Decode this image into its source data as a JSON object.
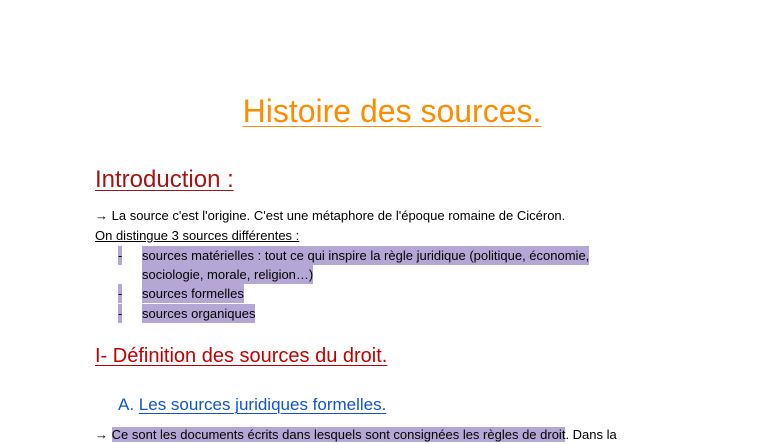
{
  "title": "Histoire des sources.",
  "introduction": {
    "heading": "Introduction :",
    "line1_arrow": "→",
    "line1": "La source c'est l'origine. C'est une métaphore de l'époque romaine de Cicéron.",
    "line2": "On distingue 3 sources différentes :",
    "bullet_marker": "-",
    "items": [
      "sources matérielles : tout ce qui inspire la règle juridique (politique, économie,",
      "sociologie, morale, religion…)",
      "sources formelles",
      "sources organiques"
    ]
  },
  "section1": {
    "heading": "I- Définition des sources du droit.",
    "sub_a_letter": "A.",
    "sub_a_title": "Les sources juridiques formelles.",
    "text_arrow": "→",
    "text_highlighted": "Ce sont les documents écrits dans lesquels sont consignées les règles de droit",
    "text_rest": ". Dans la"
  },
  "colors": {
    "title": "#ff8c00",
    "intro_heading": "#a31515",
    "section_heading": "#c00000",
    "subheading": "#1155cc",
    "highlight": "#b4a7d6"
  }
}
